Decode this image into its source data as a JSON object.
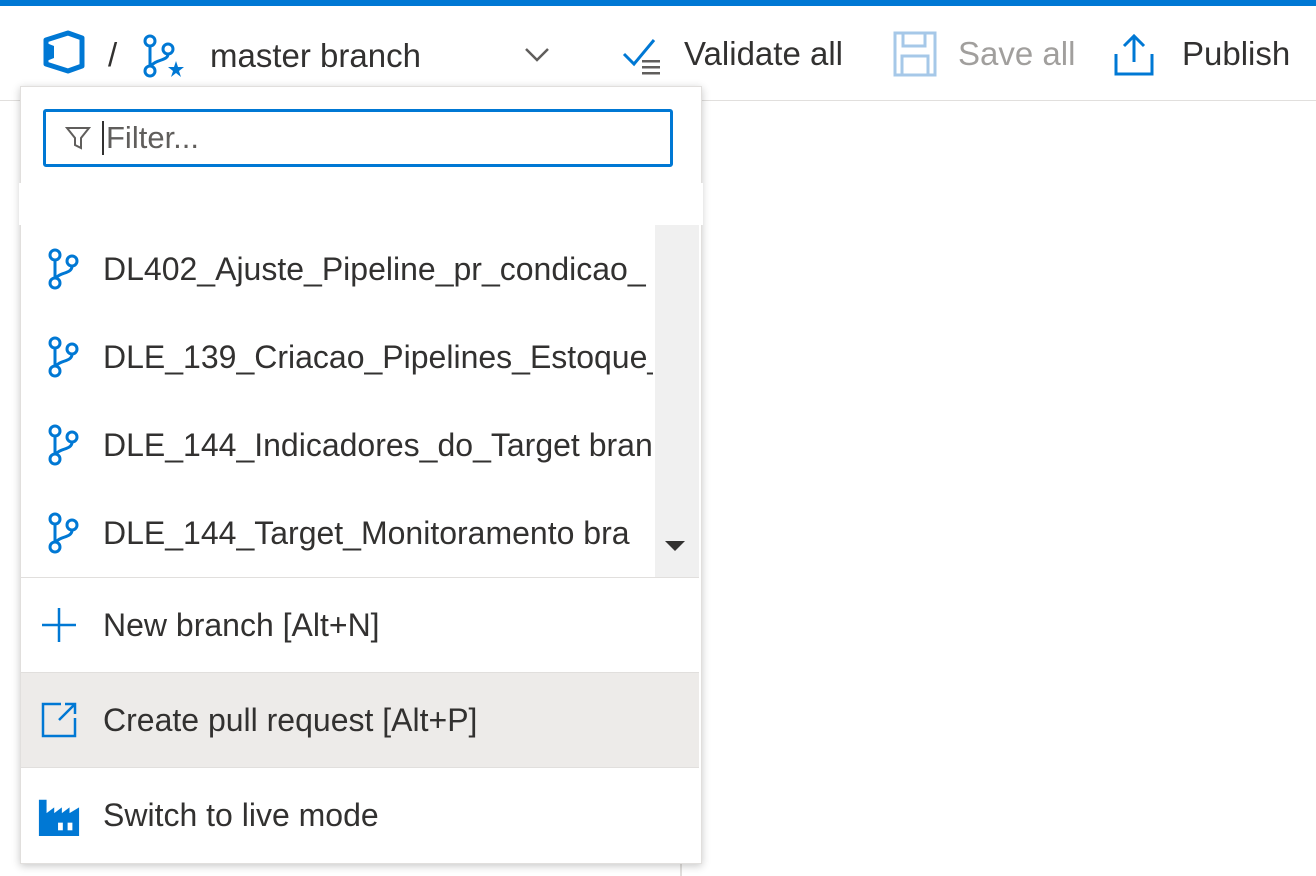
{
  "toolbar": {
    "breadcrumb_separator": "/",
    "branch_selector_label": "master branch",
    "validate_all_label": "Validate all",
    "save_all_label": "Save all",
    "publish_label": "Publish"
  },
  "dropdown": {
    "filter_placeholder": "Filter...",
    "branches": [
      {
        "label": "DL402_Ajuste_Pipeline_pr_condicao_"
      },
      {
        "label": "DLE_139_Criacao_Pipelines_Estoque_"
      },
      {
        "label": "DLE_144_Indicadores_do_Target bran"
      },
      {
        "label": "DLE_144_Target_Monitoramento bra"
      }
    ],
    "actions": {
      "new_branch": "New branch [Alt+N]",
      "create_pull_request": "Create pull request [Alt+P]",
      "switch_live_mode": "Switch to live mode"
    }
  },
  "colors": {
    "accent": "#0078d4",
    "hover_background": "#edebe9",
    "disabled_text": "#a19f9d"
  },
  "icons": {
    "repo": "azure-devops-repo-icon",
    "branch_selector": "git-branch-star-icon",
    "chevron": "chevron-down-icon",
    "validate": "validate-checklist-icon",
    "save": "floppy-disk-icon",
    "publish": "upload-icon",
    "filter": "filter-icon",
    "branch": "git-branch-icon",
    "new_branch": "plus-icon",
    "pull_request": "open-external-icon",
    "live_mode": "factory-icon"
  }
}
